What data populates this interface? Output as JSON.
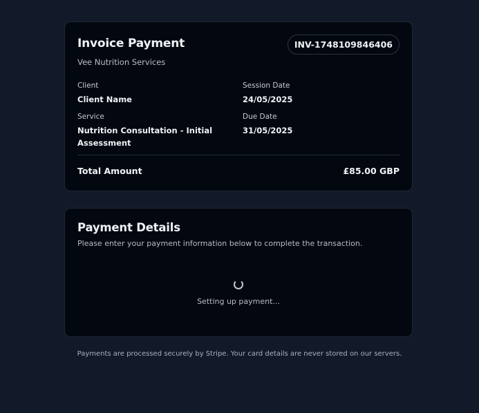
{
  "invoice": {
    "title": "Invoice Payment",
    "company": "Vee Nutrition Services",
    "invoice_number": "INV-1748109846406",
    "client_label": "Client",
    "client_value": "Client Name",
    "session_date_label": "Session Date",
    "session_date_value": "24/05/2025",
    "service_label": "Service",
    "service_value": "Nutrition Consultation - Initial Assessment",
    "due_date_label": "Due Date",
    "due_date_value": "31/05/2025",
    "total_label": "Total Amount",
    "total_value": "£85.00 GBP"
  },
  "payment": {
    "title": "Payment Details",
    "subtitle": "Please enter your payment information below to complete the transaction.",
    "loading_icon": "spinner-icon",
    "loading_text": "Setting up payment..."
  },
  "footer": {
    "note": "Payments are processed securely by Stripe. Your card details are never stored on our servers."
  },
  "colors": {
    "page_background": "#121a2a",
    "card_background": "#03070f",
    "card_border": "#1f2735",
    "text_primary": "#eef1f5",
    "text_secondary": "#b7bdc8"
  }
}
